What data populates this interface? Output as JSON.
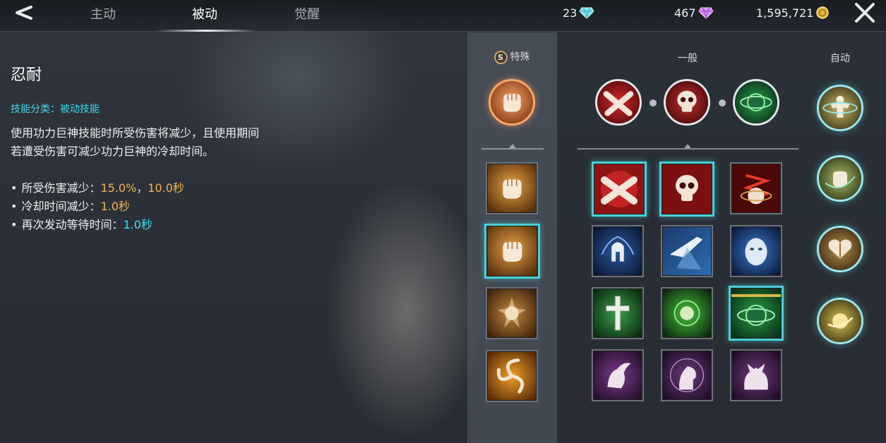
{
  "tabs": [
    "主动",
    "被动",
    "觉醒"
  ],
  "active_tab": "被动",
  "currency": {
    "diamond_blue": "23",
    "diamond_purple": "467",
    "gold": "1,595,721"
  },
  "skill": {
    "name": "忍耐",
    "category_label": "技能分类：",
    "category_value": "被动技能",
    "description": "使用功力巨神技能时所受伤害将减少，且使用期间若遭受伤害可减少功力巨神的冷却时间。",
    "bullets": [
      {
        "dot": "•",
        "label": "所受伤害减少：",
        "value1": "15.0%",
        "sep": "，",
        "value2": "10.0秒"
      },
      {
        "dot": "•",
        "label": "冷却时间减少：",
        "value1": "1.0秒"
      },
      {
        "dot": "•",
        "label": "再次发动等待时间：",
        "value1": "1.0秒"
      }
    ]
  },
  "columns": {
    "special": "特殊",
    "special_badge": "S",
    "general": "一般",
    "auto": "自动"
  },
  "icons": {
    "special_equipped": "fist-icon",
    "general_equipped": [
      "crossed-arms-icon",
      "skull-icon",
      "green-orb-icon"
    ],
    "auto": [
      "muscle-figure-icon",
      "fist-swirl-icon",
      "heart-shield-icon",
      "golden-orb-icon"
    ],
    "special_list": [
      "fist-icon",
      "fist-icon",
      "sun-medallion-icon",
      "triple-blade-icon"
    ],
    "general_grid": [
      [
        "crossed-arms-icon",
        "skull-icon",
        "red-burst-icon"
      ],
      [
        "spartan-helmet-icon",
        "blue-hand-icon",
        "blue-face-icon"
      ],
      [
        "cross-icon",
        "green-sphere-icon",
        "green-orb-icon"
      ],
      [
        "winged-figure-icon",
        "brain-head-icon",
        "beast-icon"
      ]
    ]
  },
  "colors": {
    "accent_cyan": "#3fd7e8",
    "value_orange": "#f2b251",
    "selection_border": "#49d0d4"
  }
}
